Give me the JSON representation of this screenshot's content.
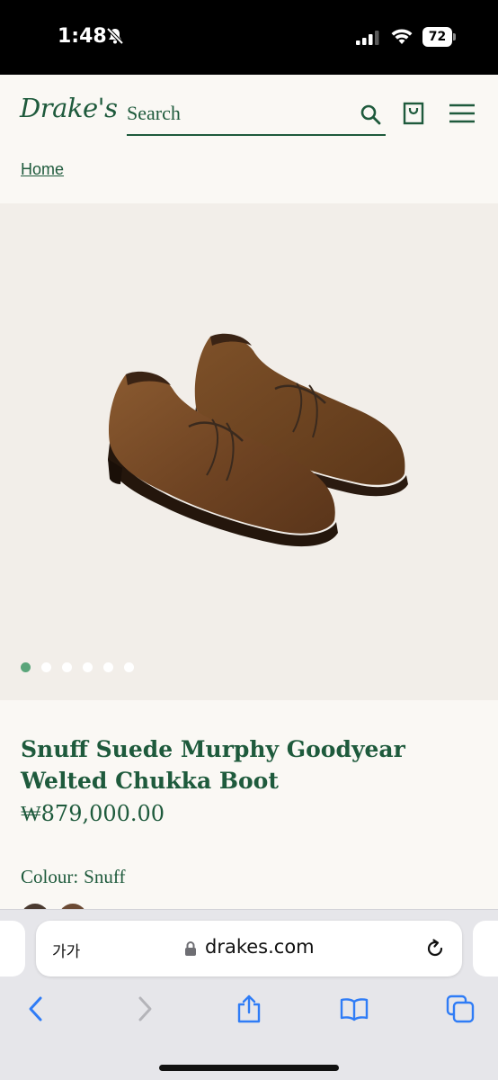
{
  "status_bar": {
    "time": "1:48",
    "battery": "72",
    "icons": [
      "bell-slash-icon",
      "signal-icon",
      "wifi-icon",
      "battery-icon"
    ]
  },
  "header": {
    "logo": "Drake's",
    "search_placeholder": "Search",
    "icons": [
      "search-icon",
      "bag-icon",
      "menu-icon"
    ]
  },
  "breadcrumb": {
    "home": "Home"
  },
  "gallery": {
    "slide_count": 6,
    "active_slide": 1
  },
  "product": {
    "title": "Snuff Suede Murphy Goodyear Welted Chukka Boot",
    "price": "₩879,000.00",
    "colour_label": "Colour:",
    "colour_value": "Snuff",
    "swatches": [
      "#4a3a30",
      "#6b4a34"
    ]
  },
  "browser": {
    "aa_label": "가가",
    "url": "drakes.com",
    "toolbar": [
      "back-icon",
      "forward-icon",
      "share-icon",
      "bookmarks-icon",
      "tabs-icon"
    ]
  },
  "colors": {
    "brand_green": "#1e5a3c",
    "dot_active": "#5aa57a",
    "safari_blue": "#2f7cf6"
  }
}
